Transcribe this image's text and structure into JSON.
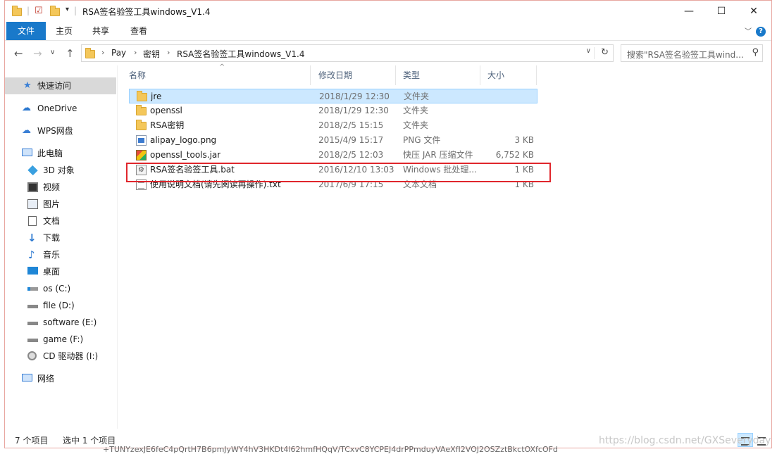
{
  "window": {
    "title": "RSA签名验签工具windows_V1.4",
    "controls": {
      "minimize": "—",
      "maximize": "☐",
      "close": "✕"
    }
  },
  "ribbon": {
    "tabs": [
      "文件",
      "主页",
      "共享",
      "查看"
    ],
    "help": "?"
  },
  "address": {
    "breadcrumb": [
      "Pay",
      "密钥",
      "RSA签名验签工具windows_V1.4"
    ],
    "search_placeholder": "搜索\"RSA签名验签工具wind..."
  },
  "nav": {
    "items": [
      {
        "label": "快速访问",
        "icon": "star-icon"
      },
      {
        "label": "OneDrive",
        "icon": "cloud-icon"
      },
      {
        "label": "WPS网盘",
        "icon": "cloud-outline-icon"
      },
      {
        "label": "此电脑",
        "icon": "computer-icon"
      },
      {
        "label": "3D 对象",
        "icon": "cube-icon"
      },
      {
        "label": "视频",
        "icon": "video-icon"
      },
      {
        "label": "图片",
        "icon": "picture-icon"
      },
      {
        "label": "文档",
        "icon": "document-icon"
      },
      {
        "label": "下载",
        "icon": "download-icon"
      },
      {
        "label": "音乐",
        "icon": "music-icon"
      },
      {
        "label": "桌面",
        "icon": "desktop-icon"
      },
      {
        "label": "os (C:)",
        "icon": "drive-os-icon"
      },
      {
        "label": "file (D:)",
        "icon": "drive-icon"
      },
      {
        "label": "software (E:)",
        "icon": "drive-icon"
      },
      {
        "label": "game (F:)",
        "icon": "drive-icon"
      },
      {
        "label": "CD 驱动器 (I:)",
        "icon": "cd-drive-icon"
      },
      {
        "label": "网络",
        "icon": "network-icon"
      }
    ]
  },
  "files": {
    "columns": [
      "名称",
      "修改日期",
      "类型",
      "大小"
    ],
    "rows": [
      {
        "name": "jre",
        "date": "2018/1/29 12:30",
        "type": "文件夹",
        "size": "",
        "icon": "folder-icon"
      },
      {
        "name": "openssl",
        "date": "2018/1/29 12:30",
        "type": "文件夹",
        "size": "",
        "icon": "folder-icon"
      },
      {
        "name": "RSA密钥",
        "date": "2018/2/5 15:15",
        "type": "文件夹",
        "size": "",
        "icon": "folder-icon"
      },
      {
        "name": "alipay_logo.png",
        "date": "2015/4/9 15:17",
        "type": "PNG 文件",
        "size": "3 KB",
        "icon": "png-file-icon"
      },
      {
        "name": "openssl_tools.jar",
        "date": "2018/2/5 12:03",
        "type": "快压 JAR 压缩文件",
        "size": "6,752 KB",
        "icon": "jar-file-icon"
      },
      {
        "name": "RSA签名验签工具.bat",
        "date": "2016/12/10 13:03",
        "type": "Windows 批处理...",
        "size": "1 KB",
        "icon": "bat-file-icon"
      },
      {
        "name": "使用说明文档(请先阅读再操作).txt",
        "date": "2017/6/9 17:15",
        "type": "文本文档",
        "size": "1 KB",
        "icon": "txt-file-icon"
      }
    ]
  },
  "status": {
    "count": "7 个项目",
    "selected": "选中 1 个项目"
  },
  "background_text": "+TUNYzexJE6feC4pQrtH7B6pmJyWY4hV3HKDt4l62hmfHQqV/TCxvC8YCPEJ4drPPmduyVAeXfI2VOJ2OSZztBkctOXfcOFd",
  "watermark": "https://blog.csdn.net/GXSeveryday"
}
